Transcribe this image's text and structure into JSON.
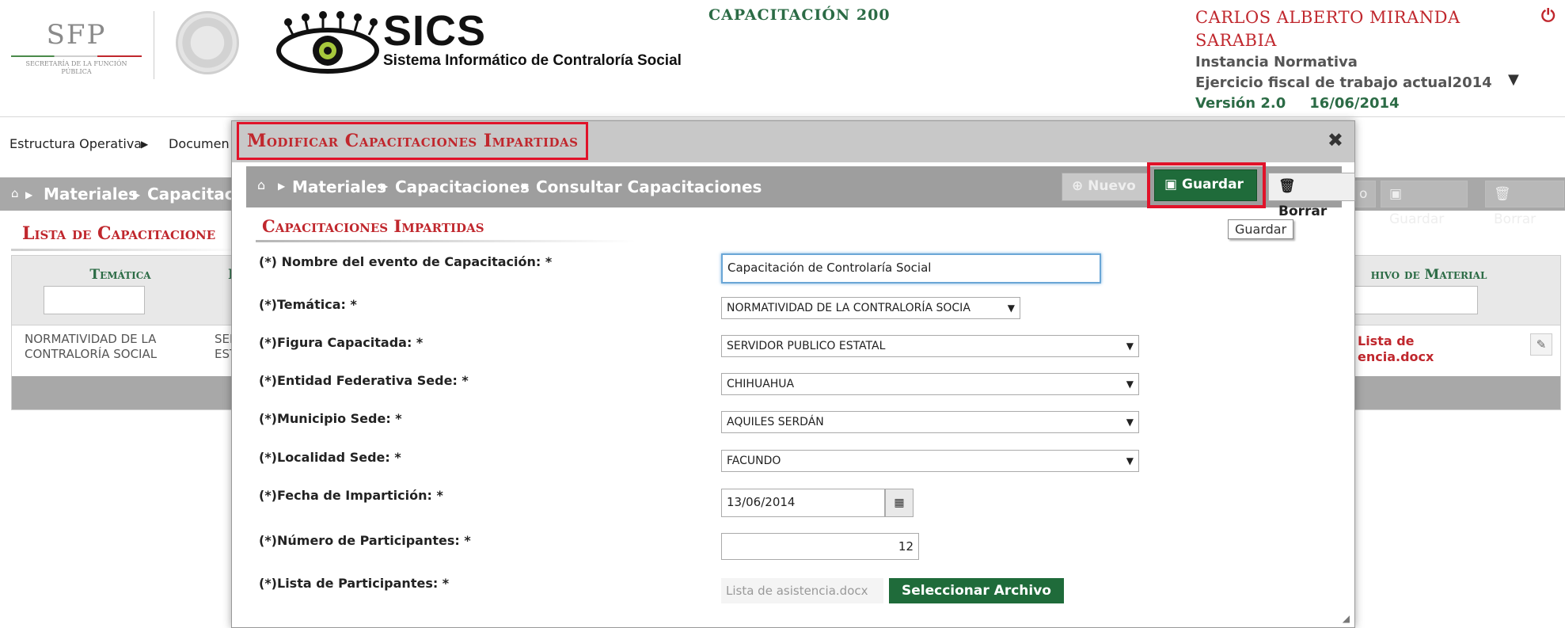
{
  "header": {
    "sfp_logo_text": "SFP",
    "sfp_logo_sub": "SECRETARÍA DE LA FUNCIÓN PÚBLICA",
    "sics_title": "SICS",
    "sics_subtitle": "Sistema Informático de Contraloría Social",
    "capacitacion": "CAPACITACIÓN 200",
    "user_name_1": "CARLOS ALBERTO MIRANDA",
    "user_name_2": "SARABIA",
    "instancia": "Instancia Normativa",
    "ejercicio": "Ejercicio fiscal de trabajo actual2014",
    "version": "Versión 2.0",
    "date": "16/06/2014"
  },
  "topnav": {
    "item1": "Estructura Operativa",
    "item2": "Documen"
  },
  "bg_crumbs": {
    "c1": "Materiales",
    "c2": "Capacitaci",
    "btn_guardar": "Guardar",
    "btn_borrar": "Borrar",
    "btn_partial": "o"
  },
  "bg_list": {
    "title": "Lista de Capacitacione",
    "col_tematica": "Temática",
    "col_i": "I",
    "col_archivo": "hivo de Material",
    "row_tematica": "NORMATIVIDAD DE LA CONTRALORÍA SOCIAL",
    "row_second": "SER EST",
    "row_archivo": "Lista de encia.docx"
  },
  "modal": {
    "title": "Modificar Capacitaciones Impartidas",
    "crumbs": [
      "Materiales",
      "Capacitaciones",
      "Consultar Capacitaciones"
    ],
    "btn_nuevo": "Nuevo",
    "btn_guardar": "Guardar",
    "btn_borrar": "Borrar",
    "tooltip": "Guardar",
    "section_title": "Capacitaciones Impartidas",
    "fields": {
      "nombre_label": "(*) Nombre del evento de Capacitación: *",
      "nombre_value": "Capacitación de Controlaría Social",
      "tematica_label": "(*)Temática: *",
      "tematica_value": "NORMATIVIDAD DE LA CONTRALORÍA SOCIA",
      "figura_label": "(*)Figura Capacitada: *",
      "figura_value": "SERVIDOR PUBLICO ESTATAL",
      "entidad_label": "(*)Entidad Federativa Sede: *",
      "entidad_value": "CHIHUAHUA",
      "municipio_label": "(*)Municipio Sede: *",
      "municipio_value": "AQUILES SERDÁN",
      "localidad_label": "(*)Localidad Sede: *",
      "localidad_value": "FACUNDO",
      "fecha_label": "(*)Fecha de Impartición: *",
      "fecha_value": "13/06/2014",
      "numero_label": "(*)Número de Participantes: *",
      "numero_value": "12",
      "lista_label": "(*)Lista de Participantes: *",
      "lista_file": "Lista de asistencia.docx",
      "lista_button": "Seleccionar Archivo"
    }
  }
}
